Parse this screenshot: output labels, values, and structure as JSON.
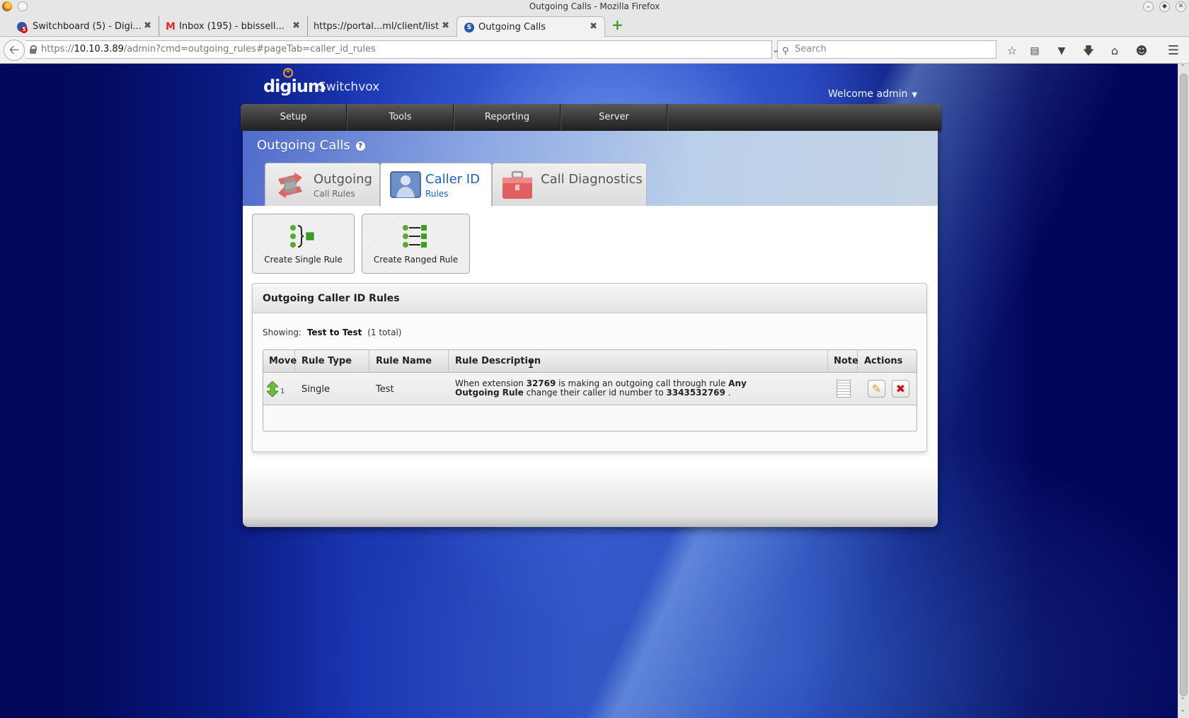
{
  "window": {
    "title": "Outgoing Calls - Mozilla Firefox",
    "controls": [
      "minimize",
      "maximize",
      "close"
    ]
  },
  "browser_tabs": [
    {
      "label": "Switchboard (5) - Digi...",
      "favicon": "switchboard-icon",
      "badge": "5",
      "active": false
    },
    {
      "label": "Inbox (195) - bbissell...",
      "favicon": "gmail-icon",
      "active": false
    },
    {
      "label": "https://portal...ml/client/list",
      "favicon": "",
      "active": false
    },
    {
      "label": "Outgoing Calls",
      "favicon": "switchvox-icon",
      "active": true
    }
  ],
  "toolbar": {
    "url_scheme": "https://",
    "url_host": "10.10.3.89",
    "url_path": "/admin?cmd=outgoing_rules#pageTab=caller_id_rules",
    "search_placeholder": "Search",
    "icons": [
      "bookmark-star-icon",
      "reading-list-icon",
      "pocket-icon",
      "download-icon",
      "home-icon",
      "chat-icon",
      "hamburger-menu-icon"
    ]
  },
  "app": {
    "logo_brand": "digium",
    "logo_product": "Switchvox",
    "welcome": "Welcome admin",
    "nav": [
      {
        "label": "Setup"
      },
      {
        "label": "Tools"
      },
      {
        "label": "Reporting"
      },
      {
        "label": "Server"
      }
    ],
    "page_title": "Outgoing Calls",
    "help_icon": "?",
    "page_tabs": [
      {
        "title": "Outgoing",
        "subtitle": "Call Rules",
        "active": false
      },
      {
        "title": "Caller ID",
        "subtitle": "Rules",
        "active": true
      },
      {
        "title": "Call Diagnostics",
        "subtitle": "",
        "active": false
      }
    ],
    "actions": {
      "create_single": "Create Single Rule",
      "create_ranged": "Create Ranged Rule"
    },
    "rules_box": {
      "title": "Outgoing Caller ID Rules",
      "showing_label": "Showing:",
      "showing_range": "Test to Test",
      "showing_total": "(1 total)",
      "columns": [
        "Move",
        "Rule Type",
        "Rule Name",
        "Rule Description",
        "Note",
        "Actions"
      ],
      "rows": [
        {
          "order": "1",
          "rule_type": "Single",
          "rule_name": "Test",
          "description": {
            "t1": "When extension ",
            "extension": "32769",
            "t2": " is making an outgoing call through rule ",
            "rule": "Any Outgoing Rule",
            "t3": " change their caller id number to ",
            "number": "3343532769",
            "t4": " ."
          }
        }
      ]
    }
  },
  "colors": {
    "accent_blue": "#1f5fbf",
    "nav_dark": "#3a3a3a",
    "delete_red": "#d01010",
    "create_green": "#3aa020"
  }
}
